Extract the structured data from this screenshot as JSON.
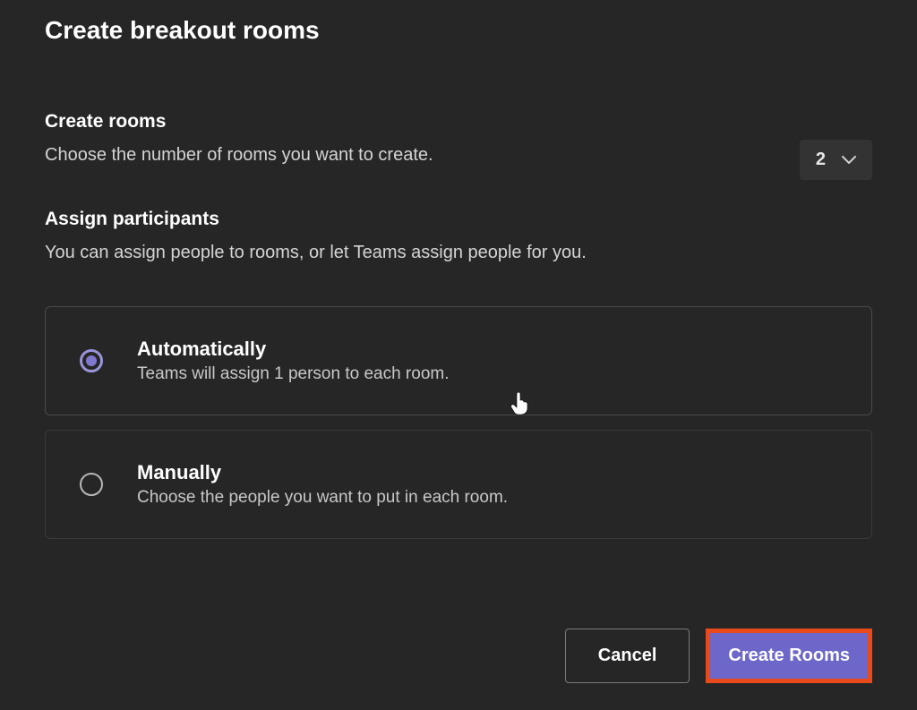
{
  "dialog": {
    "title": "Create breakout rooms"
  },
  "createRooms": {
    "heading": "Create rooms",
    "description": "Choose the number of rooms you want to create.",
    "selectorValue": "2"
  },
  "assignParticipants": {
    "heading": "Assign participants",
    "description": "You can assign people to rooms, or let Teams assign people for you."
  },
  "options": {
    "automatically": {
      "title": "Automatically",
      "subtitle": "Teams will assign 1 person to each room."
    },
    "manually": {
      "title": "Manually",
      "subtitle": "Choose the people you want to put in each room."
    }
  },
  "buttons": {
    "cancel": "Cancel",
    "create": "Create Rooms"
  }
}
